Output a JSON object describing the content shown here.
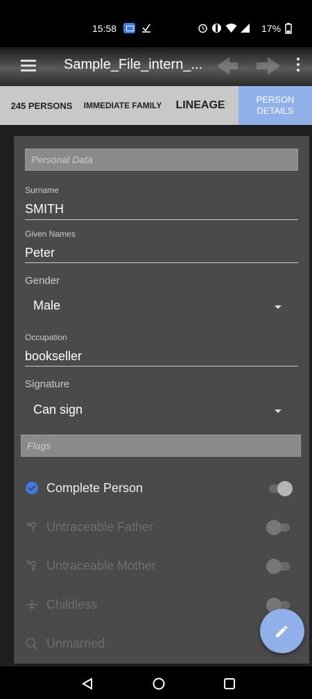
{
  "status_bar": {
    "time": "15:58",
    "icons": [
      "message-badge-icon",
      "download-check-icon",
      "alarm-icon",
      "dnd-icon",
      "wifi-icon",
      "signal-icon",
      "battery-icon"
    ],
    "battery_percent": "17%"
  },
  "toolbar": {
    "title": "Sample_File_intern_...",
    "icons": [
      "menu-icon",
      "back-arrow-icon",
      "forward-arrow-icon",
      "more-options-icon"
    ]
  },
  "tabs": [
    {
      "label": "245 PERSONS",
      "selected": false
    },
    {
      "label": "IMMEDIATE FAMILY",
      "selected": false
    },
    {
      "label": "LINEAGE",
      "selected": false
    },
    {
      "label": "PERSON DETAILS",
      "selected": true
    }
  ],
  "personal_data": {
    "section_placeholder": "Personal Data",
    "surname_label": "Surname",
    "surname_value": "SMITH",
    "given_names_label": "Given Names",
    "given_names_value": "Peter",
    "gender_label": "Gender",
    "gender_value": "Male",
    "occupation_label": "Occupation",
    "occupation_value": "bookseller",
    "signature_label": "Signature",
    "signature_value": "Can sign"
  },
  "flags": {
    "section_placeholder": "Flags",
    "items": [
      {
        "label": "Complete Person",
        "icon": "check-circle-icon",
        "enabled": true,
        "on": true
      },
      {
        "label": "Untraceable Father",
        "icon": "male-tree-icon",
        "enabled": false,
        "on": false
      },
      {
        "label": "Untraceable Mother",
        "icon": "female-tree-icon",
        "enabled": false,
        "on": false
      },
      {
        "label": "Childless",
        "icon": "childless-icon",
        "enabled": false,
        "on": false
      },
      {
        "label": "Unmarried",
        "icon": "unmarried-icon",
        "enabled": false,
        "on": false
      }
    ]
  },
  "fab": {
    "icon": "edit-pencil-icon"
  },
  "nav_bar": {
    "icons": [
      "back-triangle-icon",
      "home-circle-icon",
      "recents-square-icon"
    ]
  },
  "colors": {
    "accent": "#8fb0e8",
    "check": "#3d7be2"
  }
}
